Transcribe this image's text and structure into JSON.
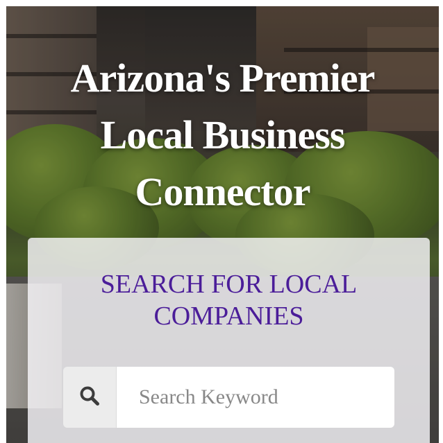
{
  "hero": {
    "title_line1": "Arizona's Premier",
    "title_line2": "Local Business",
    "title_line3": "Connector"
  },
  "search": {
    "heading_line1": "SEARCH FOR LOCAL",
    "heading_line2": "COMPANIES",
    "icon": "search-icon",
    "input_value": "",
    "placeholder": "Search Keyword"
  },
  "colors": {
    "heading_purple": "#4b1d99",
    "title_white": "#ffffff",
    "addon_gray": "#ececec"
  }
}
